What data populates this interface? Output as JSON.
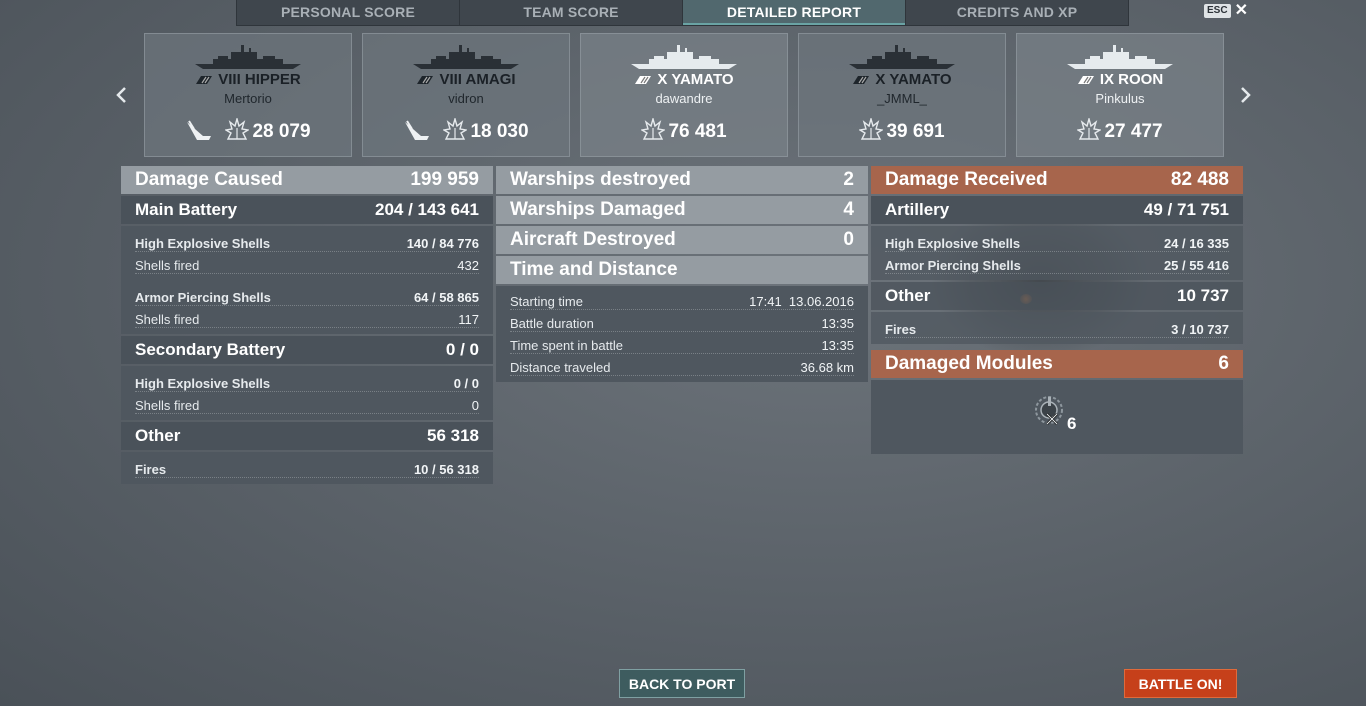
{
  "tabs": [
    {
      "label": "PERSONAL SCORE",
      "active": false
    },
    {
      "label": "TEAM SCORE",
      "active": false
    },
    {
      "label": "DETAILED REPORT",
      "active": true
    },
    {
      "label": "CREDITS AND XP",
      "active": false
    }
  ],
  "esc_label": "ESC",
  "cards": [
    {
      "ship": "VIII HIPPER",
      "player": "Mertorio",
      "damage": "28 079",
      "team": "enemy",
      "torpedo": true
    },
    {
      "ship": "VIII AMAGI",
      "player": "vidron",
      "damage": "18 030",
      "team": "enemy",
      "torpedo": true
    },
    {
      "ship": "X YAMATO",
      "player": "dawandre",
      "damage": "76 481",
      "team": "ally",
      "torpedo": false
    },
    {
      "ship": "X YAMATO",
      "player": "_JMML_",
      "damage": "39 691",
      "team": "enemy",
      "torpedo": false
    },
    {
      "ship": "IX ROON",
      "player": "Pinkulus",
      "damage": "27 477",
      "team": "ally",
      "torpedo": false
    }
  ],
  "damage_caused": {
    "title": "Damage Caused",
    "total": "199 959",
    "main_battery": {
      "label": "Main Battery",
      "value": "204 / 143 641"
    },
    "mb_he": {
      "label": "High Explosive Shells",
      "value": "140 / 84 776"
    },
    "mb_he_fired": {
      "label": "Shells fired",
      "value": "432"
    },
    "mb_ap": {
      "label": "Armor Piercing Shells",
      "value": "64 / 58 865"
    },
    "mb_ap_fired": {
      "label": "Shells fired",
      "value": "117"
    },
    "secondary": {
      "label": "Secondary Battery",
      "value": "0 / 0"
    },
    "sec_he": {
      "label": "High Explosive Shells",
      "value": "0 / 0"
    },
    "sec_he_fired": {
      "label": "Shells fired",
      "value": "0"
    },
    "other": {
      "label": "Other",
      "value": "56 318"
    },
    "fires": {
      "label": "Fires",
      "value": "10 / 56 318"
    }
  },
  "summary": {
    "warships_destroyed": {
      "label": "Warships destroyed",
      "value": "2"
    },
    "warships_damaged": {
      "label": "Warships Damaged",
      "value": "4"
    },
    "aircraft_destroyed": {
      "label": "Aircraft Destroyed",
      "value": "0"
    },
    "time_distance": {
      "label": "Time and Distance"
    },
    "starting_time": {
      "label": "Starting time",
      "value": "17:41  13.06.2016"
    },
    "battle_duration": {
      "label": "Battle duration",
      "value": "13:35"
    },
    "time_spent": {
      "label": "Time spent in battle",
      "value": "13:35"
    },
    "distance": {
      "label": "Distance traveled",
      "value": "36.68 km"
    }
  },
  "damage_received": {
    "title": "Damage Received",
    "total": "82 488",
    "artillery": {
      "label": "Artillery",
      "value": "49 / 71 751"
    },
    "he": {
      "label": "High Explosive Shells",
      "value": "24 / 16 335"
    },
    "ap": {
      "label": "Armor Piercing Shells",
      "value": "25 / 55 416"
    },
    "other": {
      "label": "Other",
      "value": "10 737"
    },
    "fires": {
      "label": "Fires",
      "value": "3 / 10 737"
    },
    "modules": {
      "label": "Damaged Modules",
      "value": "6",
      "icon_count": "6"
    }
  },
  "buttons": {
    "back": "BACK TO PORT",
    "battle": "BATTLE ON!"
  },
  "colors": {
    "accent_red": "#a7654c",
    "battle_button": "#c6401a",
    "port_button": "#3e5c5f"
  }
}
